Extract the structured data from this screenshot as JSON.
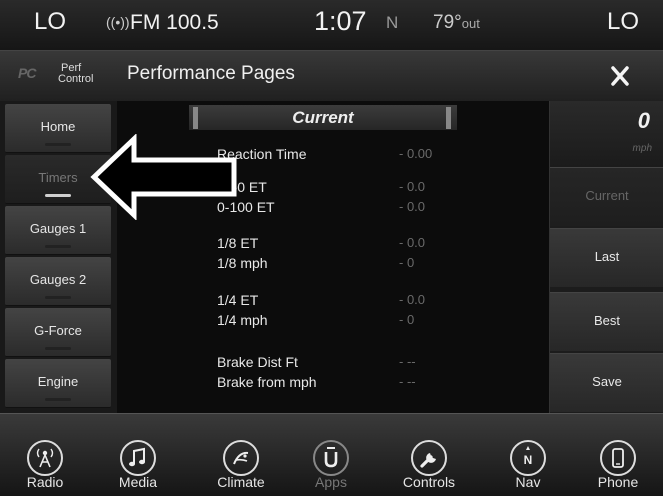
{
  "status": {
    "climate_left": "LO",
    "radio_symbol": "((•))",
    "station": "FM 100.5",
    "time": "1:07",
    "compass": "N",
    "temp_value": "79°",
    "temp_suffix": "out",
    "climate_right": "LO"
  },
  "title_bar": {
    "logo_text": "PC",
    "perf_label_1": "Perf",
    "perf_label_2": "Control",
    "title": "Performance Pages",
    "close_symbol": "×"
  },
  "left_nav": {
    "items": [
      {
        "label": "Home",
        "active": false
      },
      {
        "label": "Timers",
        "active": true
      },
      {
        "label": "Gauges 1",
        "active": false
      },
      {
        "label": "Gauges 2",
        "active": false
      },
      {
        "label": "G-Force",
        "active": false
      },
      {
        "label": "Engine",
        "active": false
      }
    ]
  },
  "center": {
    "header": "Current",
    "groups": [
      [
        {
          "label": "Reaction Time",
          "value": "- 0.00"
        }
      ],
      [
        {
          "label": "0-60 ET",
          "value": "- 0.0"
        },
        {
          "label": "0-100 ET",
          "value": "- 0.0"
        }
      ],
      [
        {
          "label": "1/8 ET",
          "value": "- 0.0"
        },
        {
          "label": "1/8 mph",
          "value": "- 0"
        }
      ],
      [
        {
          "label": "1/4 ET",
          "value": "- 0.0"
        },
        {
          "label": "1/4 mph",
          "value": "- 0"
        }
      ],
      [
        {
          "label": "Brake Dist Ft",
          "value": "- --"
        },
        {
          "label": "Brake from mph",
          "value": "- --"
        }
      ]
    ]
  },
  "right_panel": {
    "speed_value": "0",
    "speed_unit": "mph",
    "buttons": [
      {
        "label": "Current",
        "disabled": true
      },
      {
        "label": "Last",
        "disabled": false
      },
      {
        "label": "Best",
        "disabled": false
      },
      {
        "label": "Save",
        "disabled": false
      }
    ]
  },
  "dock": {
    "items": [
      {
        "label": "Radio",
        "icon": "radio-icon",
        "dim": false
      },
      {
        "label": "Media",
        "icon": "music-note-icon",
        "dim": false
      },
      {
        "label": "Climate",
        "icon": "climate-fan-icon",
        "dim": false
      },
      {
        "label": "Apps",
        "icon": "apps-icon",
        "dim": true
      },
      {
        "label": "Controls",
        "icon": "wrench-icon",
        "dim": false
      },
      {
        "label": "Nav",
        "icon": "compass-icon",
        "dim": false
      },
      {
        "label": "Phone",
        "icon": "phone-icon",
        "dim": false
      }
    ]
  },
  "colors": {
    "background": "#0b0b0b",
    "panel": "#2b2b2b",
    "text": "#e8e8e8",
    "dim_text": "#6a6a6a"
  }
}
